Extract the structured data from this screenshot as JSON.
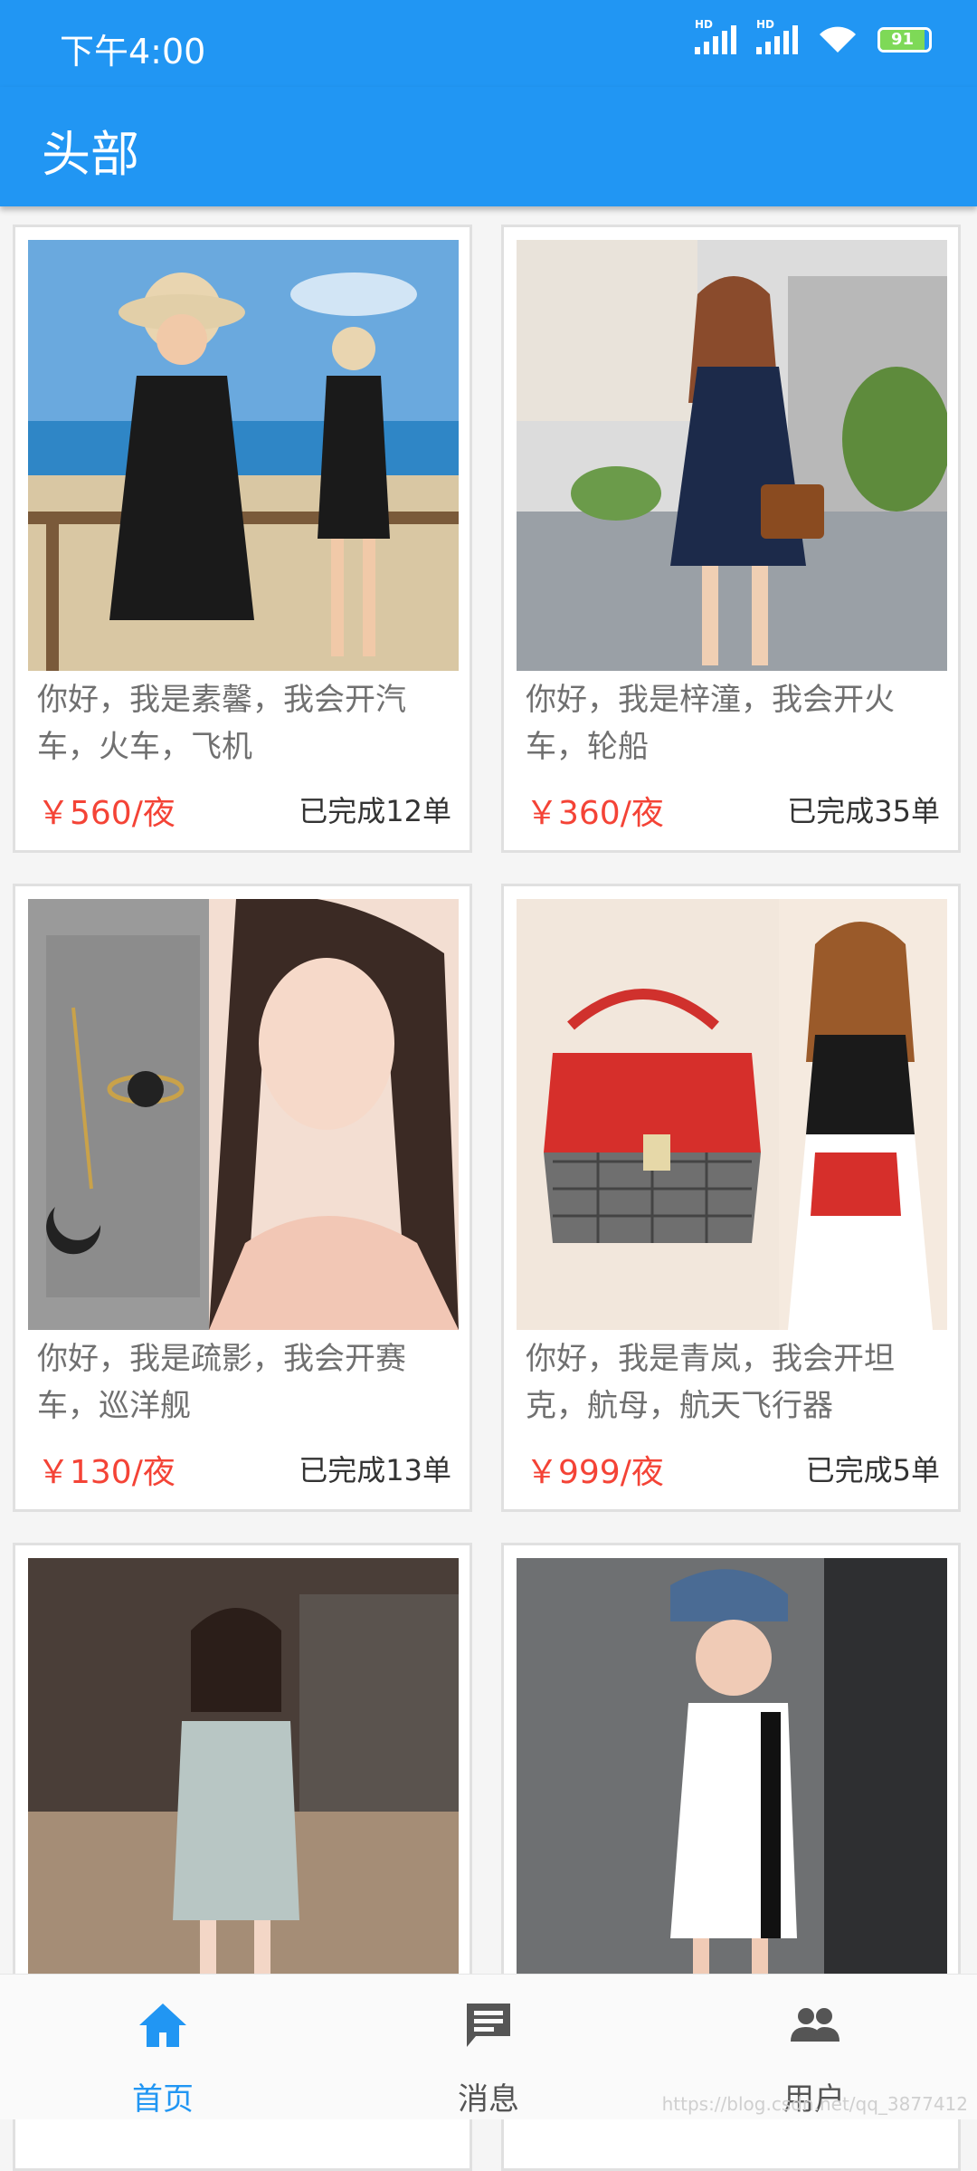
{
  "status_bar": {
    "time": "下午4:00",
    "signal_labels": [
      "HD",
      "HD"
    ],
    "battery_level": "91",
    "battery_fraction": 0.91
  },
  "app_bar": {
    "title": "头部"
  },
  "colors": {
    "primary": "#2196f3",
    "price": "#f44336",
    "nav_inactive": "#555555"
  },
  "cards": [
    {
      "desc": "你好，我是素馨，我会开汽车，火车，飞机",
      "price": "￥560/夜",
      "done": "已完成12单"
    },
    {
      "desc": "你好，我是梓潼，我会开火车，轮船",
      "price": "￥360/夜",
      "done": "已完成35单"
    },
    {
      "desc": "你好，我是疏影，我会开赛车，巡洋舰",
      "price": "￥130/夜",
      "done": "已完成13单"
    },
    {
      "desc": "你好，我是青岚，我会开坦克，航母，航天飞行器",
      "price": "￥999/夜",
      "done": "已完成5单"
    },
    {
      "desc": "",
      "price": "",
      "done": ""
    },
    {
      "desc": "",
      "price": "",
      "done": ""
    }
  ],
  "bottom_nav": {
    "items": [
      {
        "label": "首页",
        "icon": "home-icon",
        "active": true
      },
      {
        "label": "消息",
        "icon": "message-icon",
        "active": false
      },
      {
        "label": "用户",
        "icon": "people-icon",
        "active": false
      }
    ]
  },
  "watermark": "https://blog.csdn.net/qq_3877412"
}
